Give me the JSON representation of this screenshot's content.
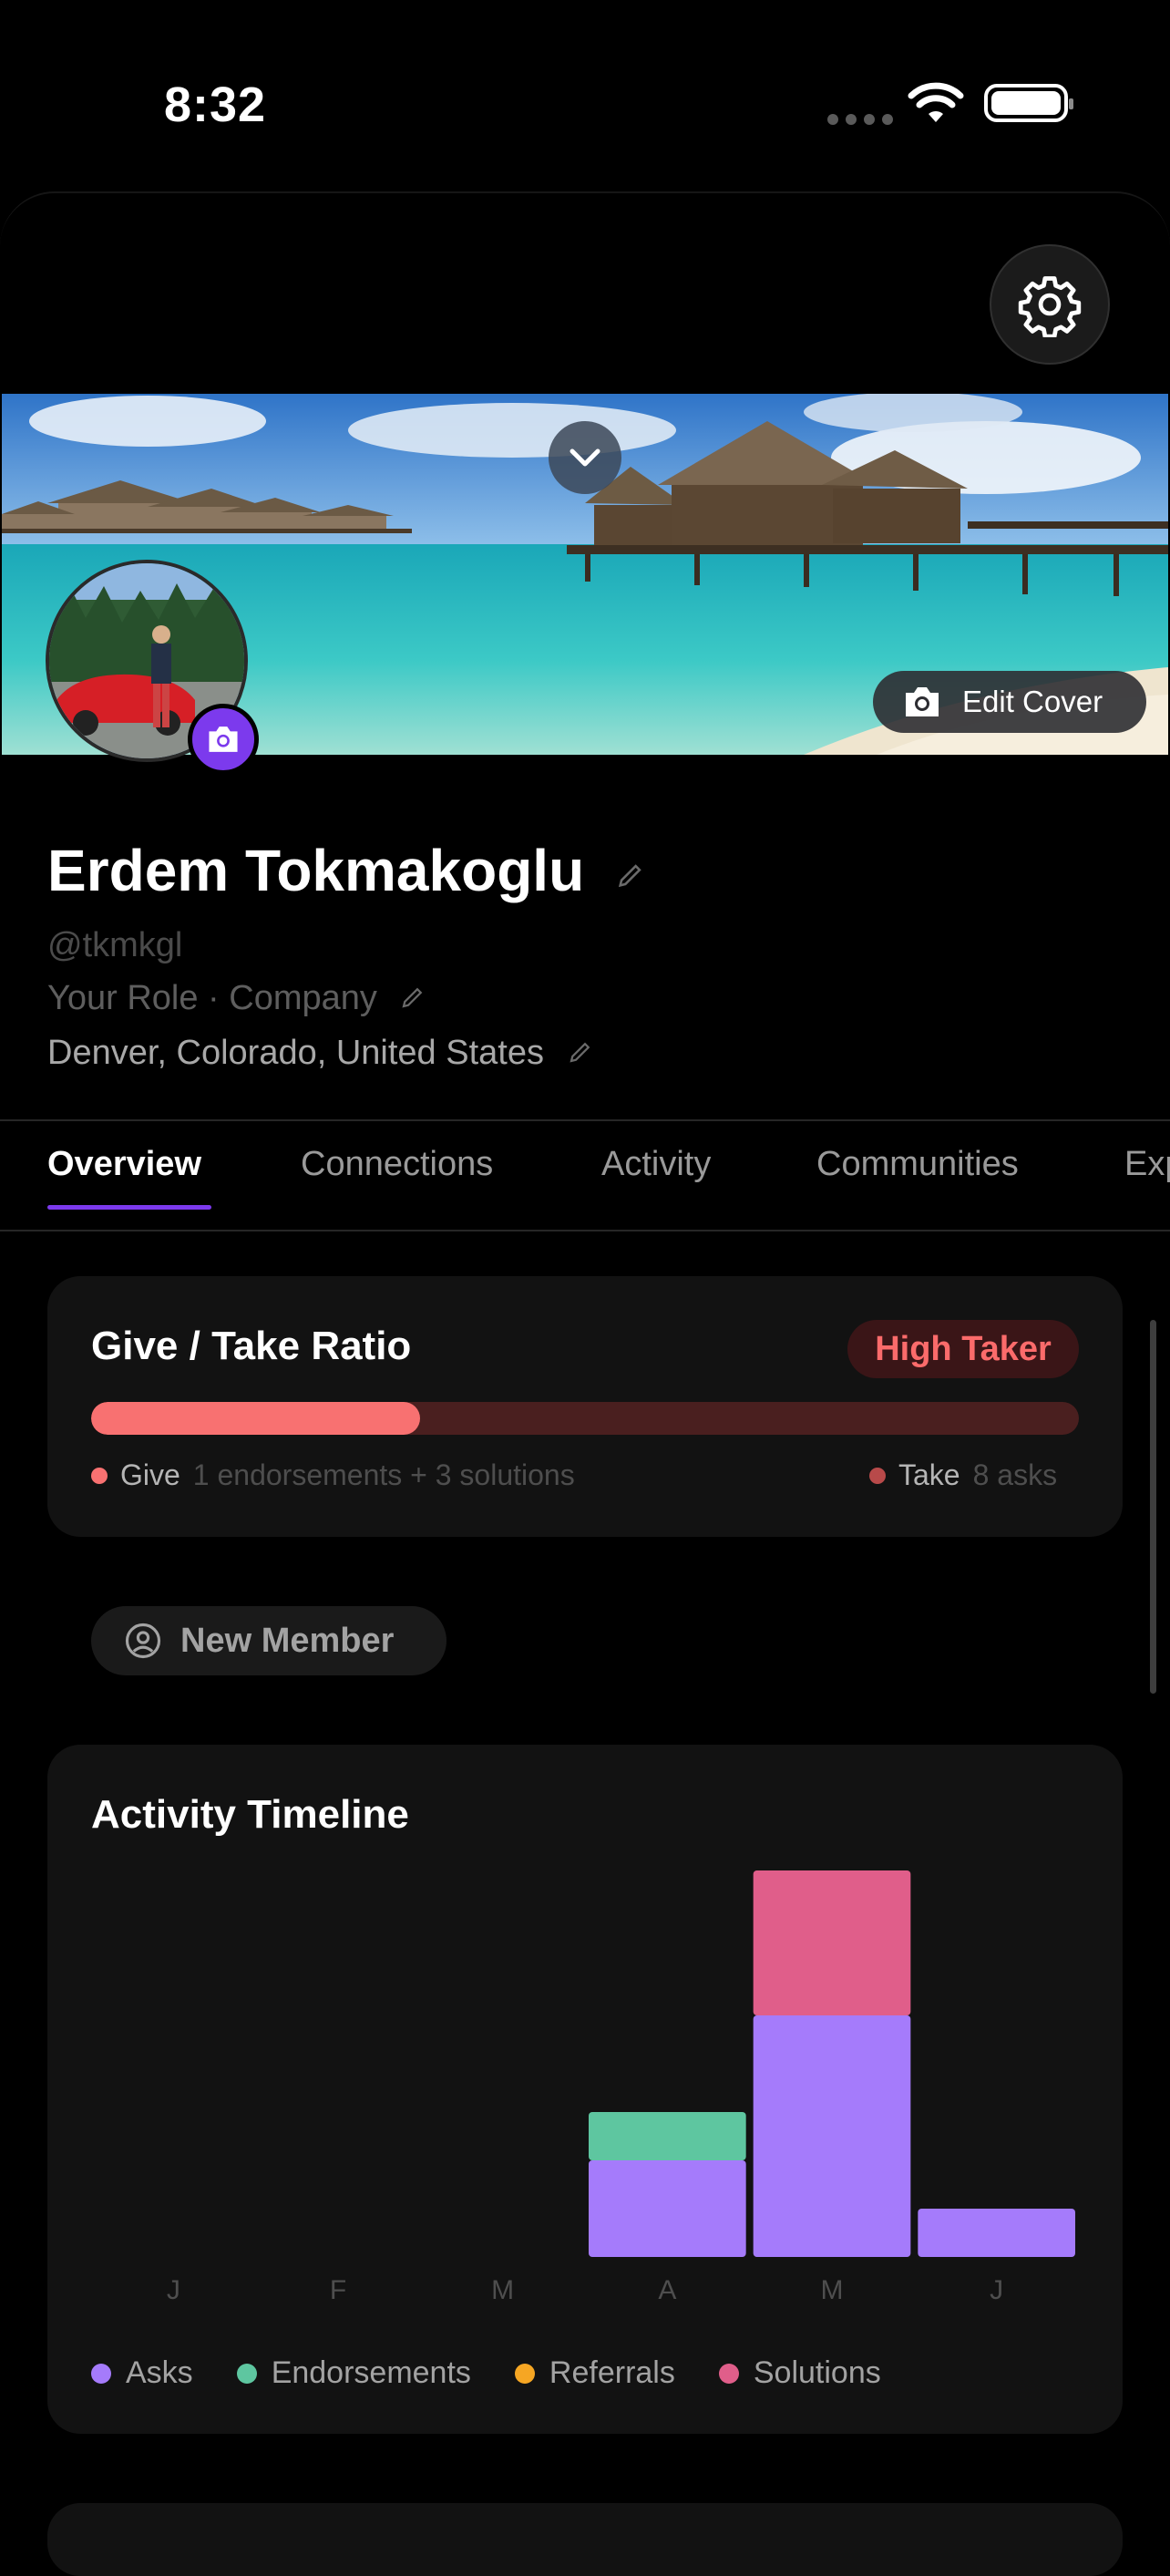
{
  "status_bar": {
    "time": "8:32"
  },
  "cover": {
    "edit_label": "Edit Cover"
  },
  "profile": {
    "name": "Erdem Tokmakoglu",
    "handle": "@tkmkgl",
    "role": "Your Role · Company",
    "location": "Denver, Colorado, United States"
  },
  "tabs": [
    {
      "label": "Overview",
      "active": true
    },
    {
      "label": "Connections"
    },
    {
      "label": "Activity"
    },
    {
      "label": "Communities"
    },
    {
      "label": "Exp"
    }
  ],
  "give_take": {
    "title": "Give / Take Ratio",
    "badge": "High Taker",
    "give_fraction": 0.333,
    "give_label": "Give",
    "give_detail": "1 endorsements + 3 solutions",
    "take_label": "Take",
    "take_detail": "8 asks",
    "colors": {
      "give": "#f87171",
      "take": "#b84a4a"
    }
  },
  "member_badge": {
    "label": "New Member"
  },
  "activity_timeline": {
    "title": "Activity Timeline"
  },
  "chart_data": {
    "type": "bar",
    "stacked": true,
    "categories": [
      "J",
      "F",
      "M",
      "A",
      "M",
      "J"
    ],
    "series": [
      {
        "name": "Asks",
        "color": "#a57bfb",
        "values": [
          0,
          0,
          0,
          2,
          5,
          1
        ]
      },
      {
        "name": "Endorsements",
        "color": "#5ec6a0",
        "values": [
          0,
          0,
          0,
          1,
          0,
          0
        ]
      },
      {
        "name": "Referrals",
        "color": "#f6a623",
        "values": [
          0,
          0,
          0,
          0,
          0,
          0
        ]
      },
      {
        "name": "Solutions",
        "color": "#e05e8a",
        "values": [
          0,
          0,
          0,
          0,
          3,
          0
        ]
      }
    ],
    "ylim": [
      0,
      8
    ],
    "grid": false,
    "legend": "bottom"
  }
}
